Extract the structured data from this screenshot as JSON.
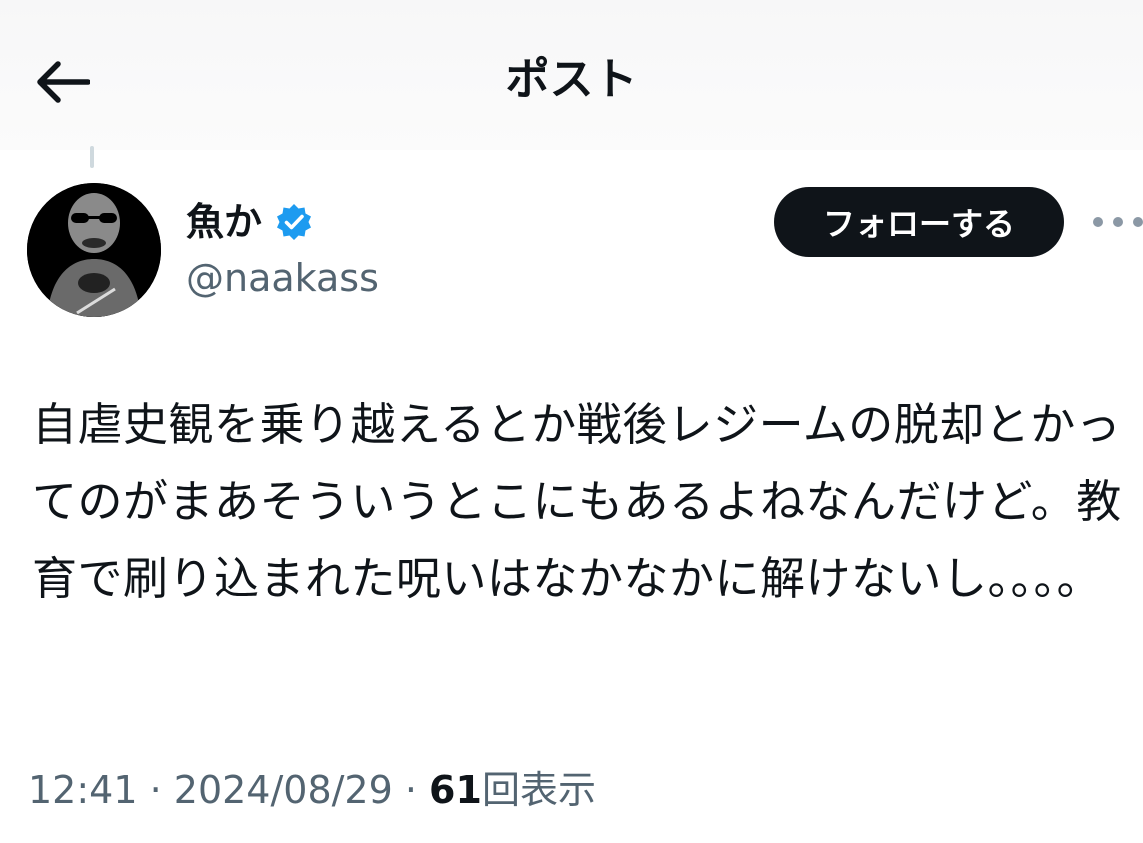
{
  "header": {
    "title": "ポスト",
    "back_icon": "arrow-left-icon"
  },
  "author": {
    "display_name": "魚か",
    "verified_icon": "verified-badge-icon",
    "verified_color": "#1d9bf0",
    "handle": "@naakass"
  },
  "actions": {
    "follow_label": "フォローする",
    "more_icon": "more-horizontal-icon"
  },
  "post": {
    "text": "自虐史観を乗り越えるとか戦後レジームの脱却とかってのがまあそういうとこにもあるよねなんだけど。教育で刷り込まれた呪いはなかなかに解けないし。。。。"
  },
  "meta": {
    "time": "12:41",
    "separator": " · ",
    "date": "2024/08/29",
    "views_count": "61",
    "views_label": "回表示"
  },
  "colors": {
    "text_primary": "#0f1419",
    "text_secondary": "#536471",
    "follow_button_bg": "#0f1419"
  }
}
